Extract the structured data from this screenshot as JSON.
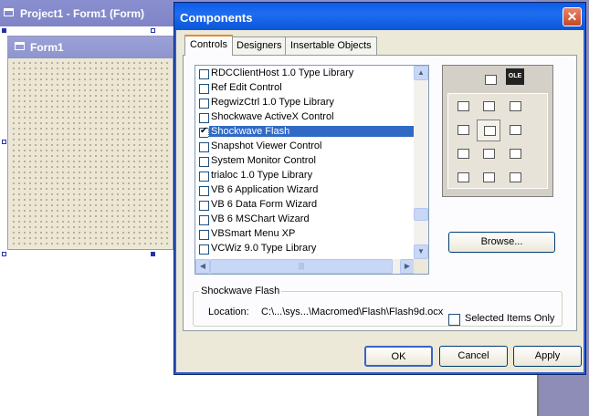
{
  "project_window": {
    "title": "Project1 - Form1 (Form)",
    "form_title": "Form1"
  },
  "dialog": {
    "title": "Components",
    "close_glyph": "✕",
    "tabs": [
      {
        "label": "Controls",
        "active": true
      },
      {
        "label": "Designers",
        "active": false
      },
      {
        "label": "Insertable Objects",
        "active": false
      }
    ],
    "list_items": [
      {
        "label": "RDCClientHost 1.0 Type Library",
        "checked": false,
        "selected": false
      },
      {
        "label": "Ref Edit Control",
        "checked": false,
        "selected": false
      },
      {
        "label": "RegwizCtrl 1.0 Type Library",
        "checked": false,
        "selected": false
      },
      {
        "label": "Shockwave ActiveX Control",
        "checked": false,
        "selected": false
      },
      {
        "label": "Shockwave Flash",
        "checked": true,
        "selected": true
      },
      {
        "label": "Snapshot Viewer Control",
        "checked": false,
        "selected": false
      },
      {
        "label": "System Monitor Control",
        "checked": false,
        "selected": false
      },
      {
        "label": "trialoc 1.0 Type Library",
        "checked": false,
        "selected": false
      },
      {
        "label": "VB 6 Application Wizard",
        "checked": false,
        "selected": false
      },
      {
        "label": "VB 6 Data Form Wizard",
        "checked": false,
        "selected": false
      },
      {
        "label": "VB 6 MSChart Wizard",
        "checked": false,
        "selected": false
      },
      {
        "label": "VBSmart Menu XP",
        "checked": false,
        "selected": false
      },
      {
        "label": "VCWiz 9.0 Type Library",
        "checked": false,
        "selected": false
      }
    ],
    "toolbox_ole_label": "OLE",
    "browse_label": "Browse...",
    "selected_only_label": "Selected Items Only",
    "selected_only_checked": false,
    "group_title": "Shockwave Flash",
    "location_label": "Location:",
    "location_value": "C:\\...\\sys...\\Macromed\\Flash\\Flash9d.ocx",
    "ok_label": "OK",
    "cancel_label": "Cancel",
    "apply_label": "Apply"
  },
  "icons": {
    "scroll_up": "▲",
    "scroll_down": "▼",
    "scroll_left": "◀",
    "scroll_right": "▶",
    "grip": "|||"
  },
  "colors": {
    "dialog_title_bar": "#0a5ce8",
    "selection": "#316ac5",
    "project_title_bar": "#8a8fd0",
    "close_button": "#c44824"
  }
}
